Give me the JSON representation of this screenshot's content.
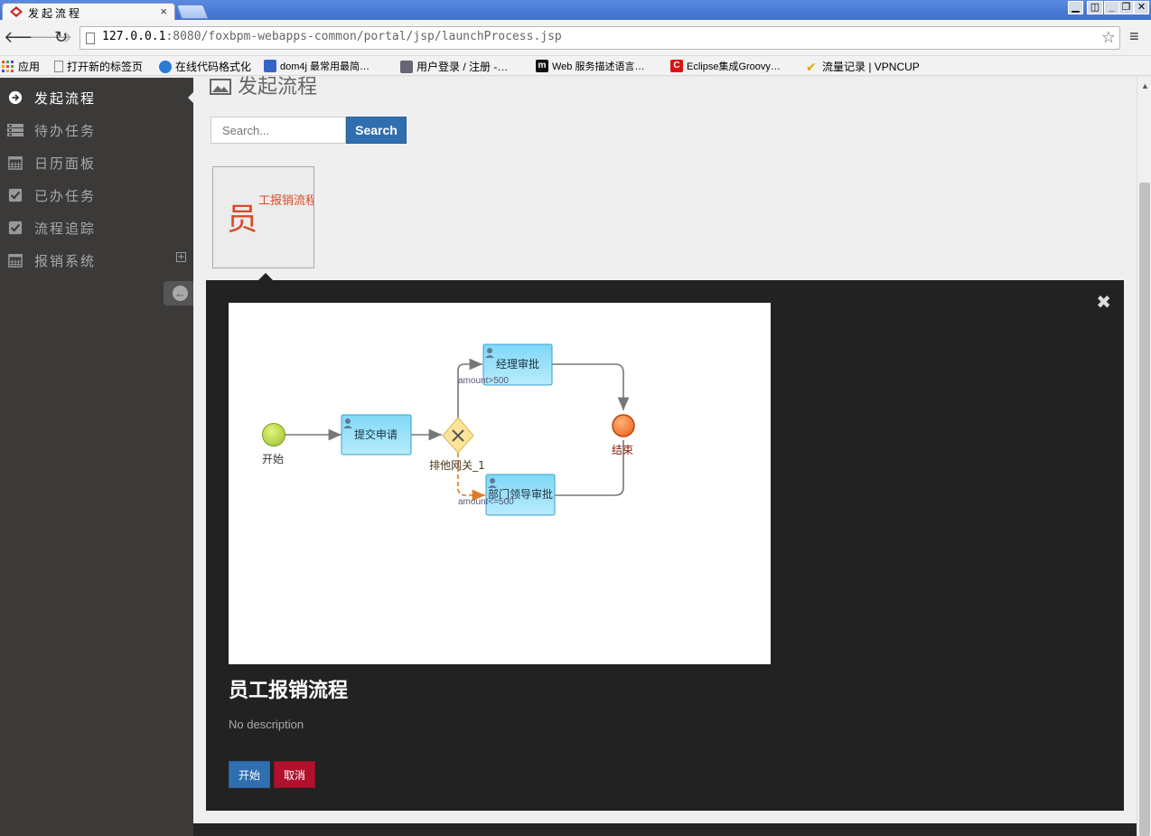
{
  "browser": {
    "tab_title": "发起流程",
    "tab_close": "×",
    "url_host": "127.0.0.1",
    "url_path": ":8080/foxbpm-webapps-common/portal/jsp/launchProcess.jsp",
    "bookmarks": [
      {
        "label": "应用",
        "icon": "apps-grid-icon",
        "color": "#e44"
      },
      {
        "label": "打开新的标签页",
        "icon": "page-icon",
        "color": "#999"
      },
      {
        "label": "在线代码格式化",
        "icon": "c-blue-icon",
        "color": "#2a7ad8"
      },
      {
        "label": "dom4j 最常用最简…",
        "icon": "site-icon",
        "color": "#3564c8"
      },
      {
        "label": "用户登录 / 注册 -…",
        "icon": "cloud-icon",
        "color": "#667"
      },
      {
        "label": "Web 服务描述语言…",
        "icon": "m-icon",
        "color": "#111"
      },
      {
        "label": "Eclipse集成Groovy…",
        "icon": "c-red-icon",
        "color": "#d11"
      },
      {
        "label": "流量记录 | VPNCUP",
        "icon": "check-icon",
        "color": "#e8a400"
      }
    ]
  },
  "sidebar": {
    "items": [
      {
        "label": "发起流程",
        "icon": "arrow-circle-right-icon",
        "active": true
      },
      {
        "label": "待办任务",
        "icon": "list-icon",
        "active": false
      },
      {
        "label": "日历面板",
        "icon": "calendar-icon",
        "active": false
      },
      {
        "label": "已办任务",
        "icon": "check-square-icon",
        "active": false
      },
      {
        "label": "流程追踪",
        "icon": "check-square-icon",
        "active": false
      },
      {
        "label": "报销系统",
        "icon": "calendar-icon",
        "active": false,
        "expandable": true
      }
    ]
  },
  "main": {
    "page_title": "发起流程",
    "search": {
      "placeholder": "Search...",
      "button": "Search"
    },
    "process_card": {
      "big_char": "员",
      "label": "工报销流程"
    },
    "detail": {
      "title": "员工报销流程",
      "description": "No description",
      "start_label": "开始",
      "cancel_label": "取消"
    }
  },
  "diagram": {
    "nodes": {
      "start": "开始",
      "submit": "提交申请",
      "gateway": "排他网关_1",
      "manager": "经理审批",
      "dept": "部门领导审批",
      "end": "结束"
    },
    "conditions": {
      "high": "amount>500",
      "low": "amount<=500"
    }
  },
  "colors": {
    "sidebar_bg": "#3c3a39",
    "primary_button": "#2f6fb0",
    "danger_button": "#b0122e",
    "card_text": "#d94a26"
  }
}
